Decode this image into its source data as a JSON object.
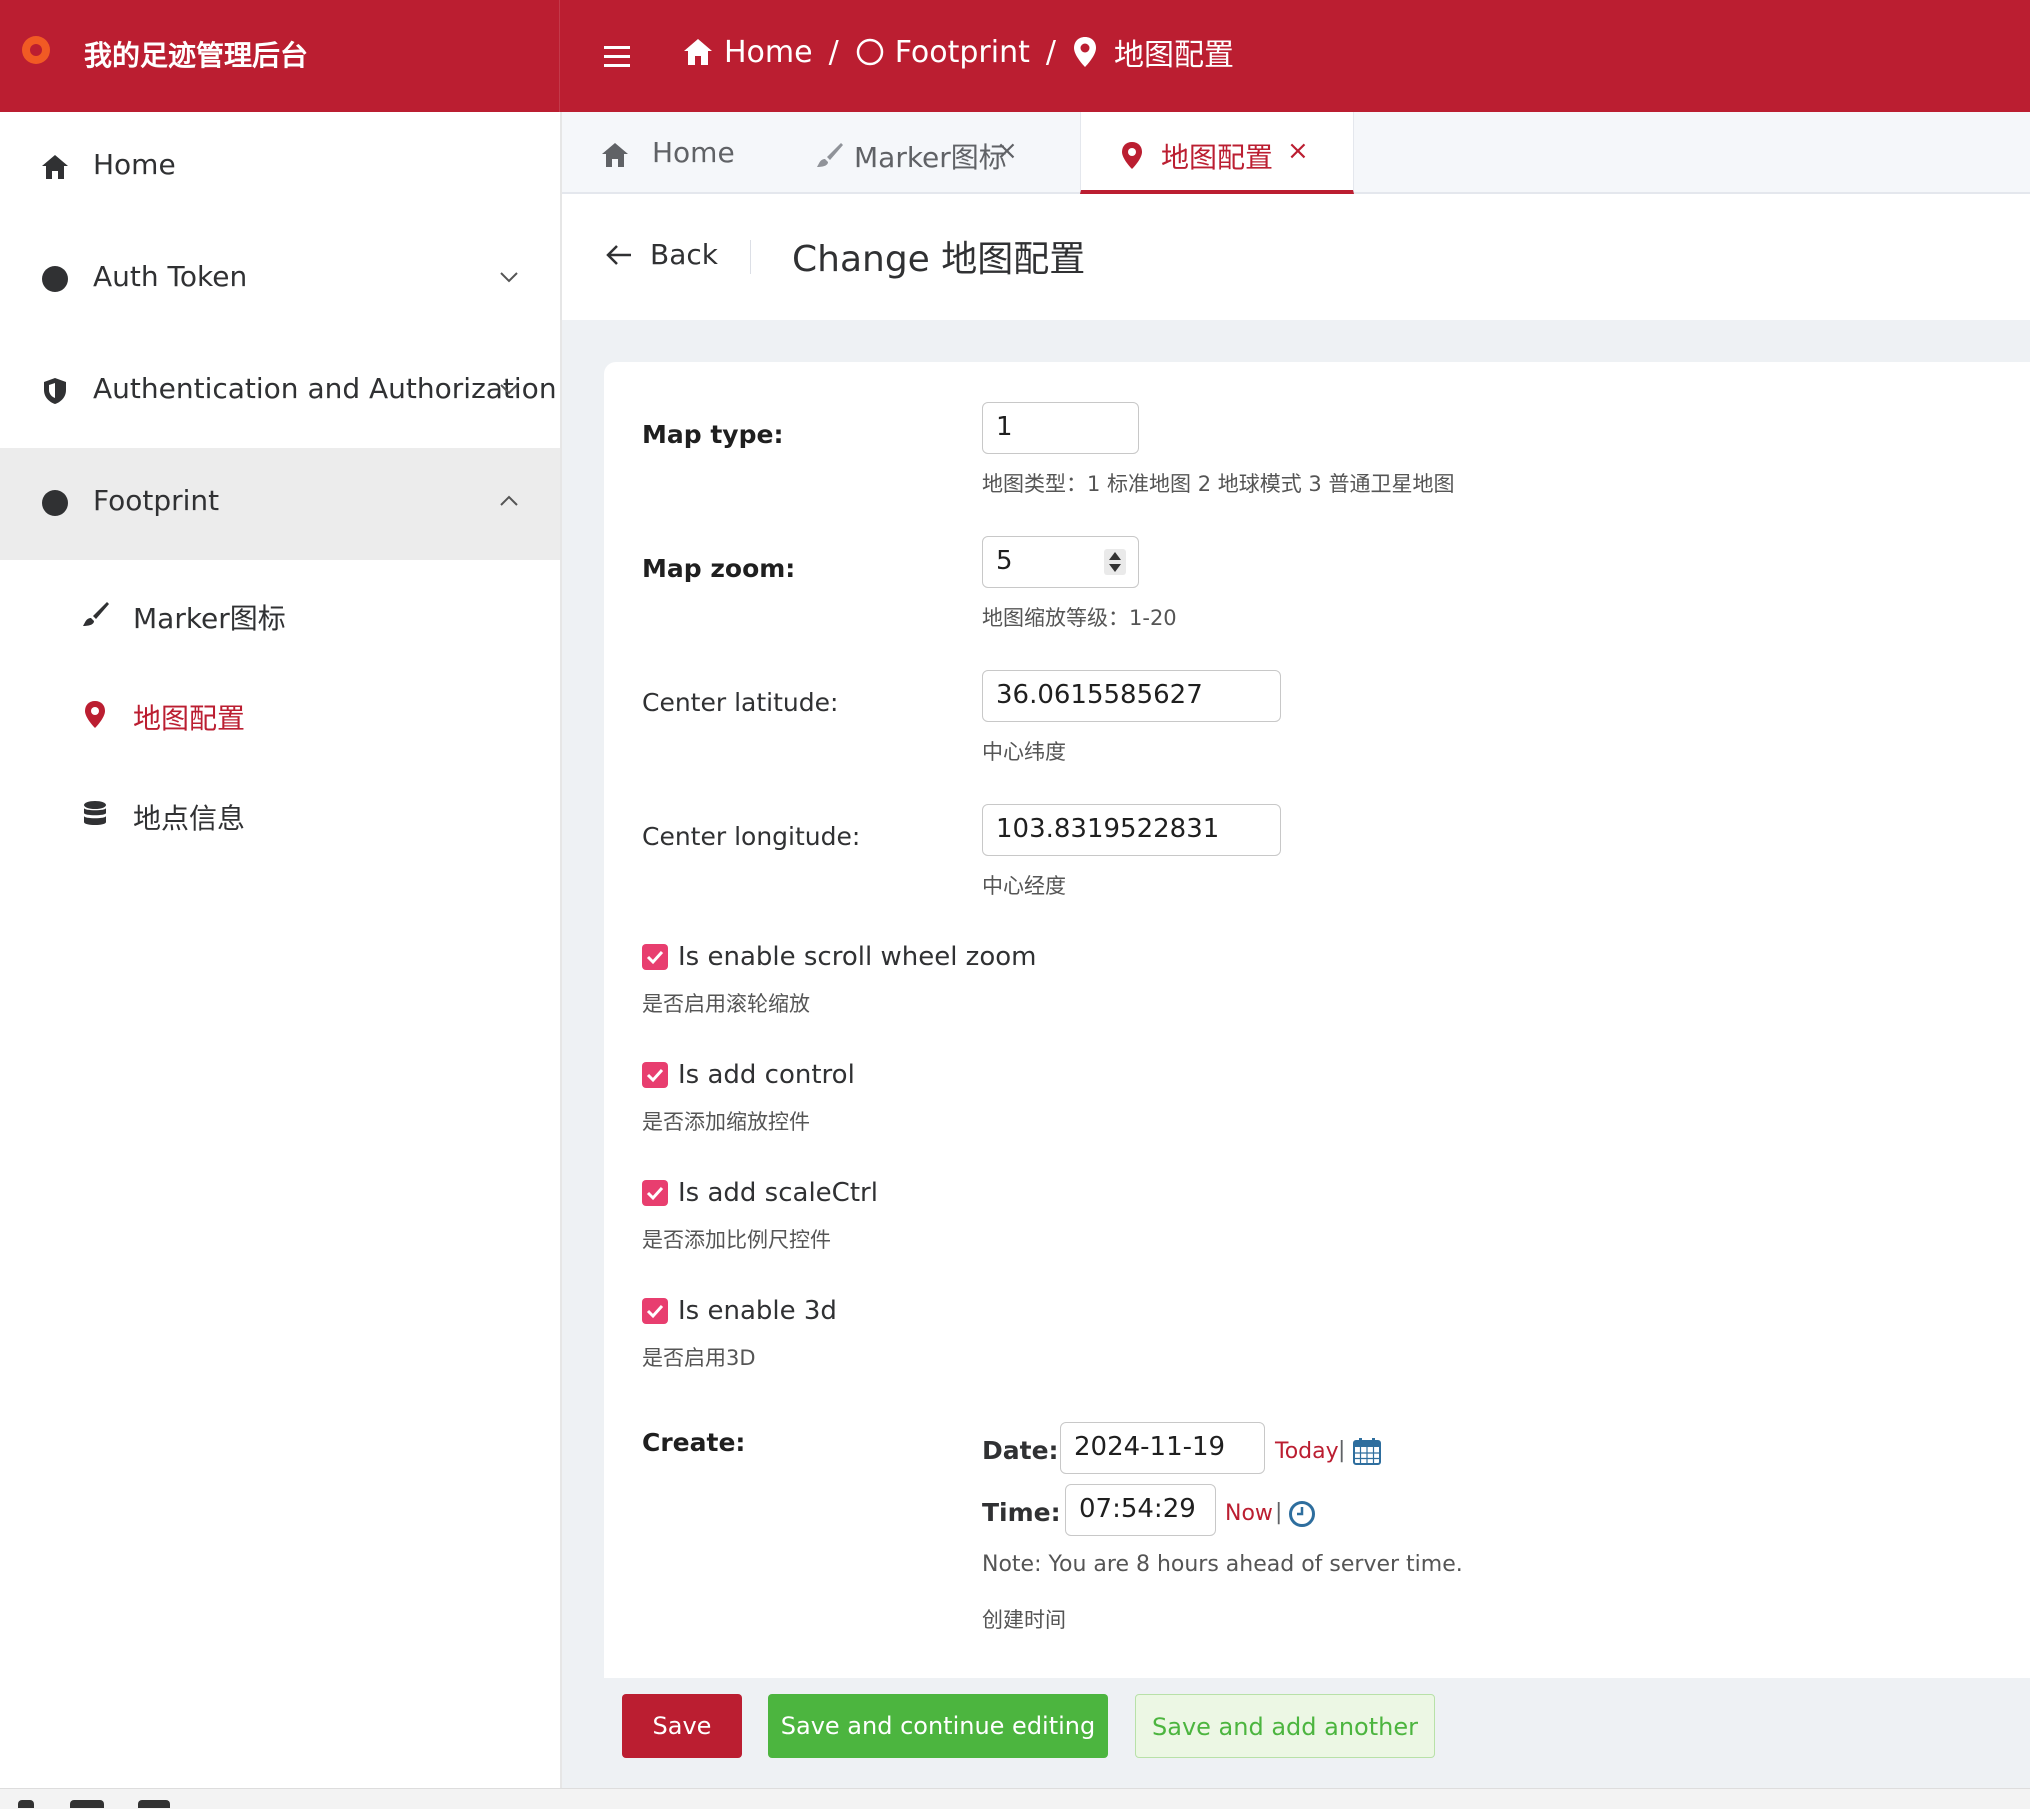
{
  "brand": {
    "title": "我的足迹管理后台"
  },
  "breadcrumb": {
    "home": "Home",
    "sep1": "/",
    "footprint": "Footprint",
    "sep2": "/",
    "current": "地图配置"
  },
  "sidebar": {
    "home": "Home",
    "auth_token": "Auth Token",
    "authn": "Authentication and Authorization",
    "footprint": "Footprint",
    "marker": "Marker图标",
    "map_config": "地图配置",
    "places": "地点信息"
  },
  "tabs": [
    {
      "label": "Home"
    },
    {
      "label": "Marker图标",
      "close": "×"
    },
    {
      "label": "地图配置",
      "close": "×"
    }
  ],
  "header": {
    "back": "Back",
    "title": "Change 地图配置"
  },
  "form": {
    "map_type": {
      "label": "Map type:",
      "value": "1",
      "help": "地图类型：1 标准地图 2 地球模式 3 普通卫星地图"
    },
    "map_zoom": {
      "label": "Map zoom:",
      "value": "5",
      "help": "地图缩放等级：1-20"
    },
    "center_lat": {
      "label": "Center latitude:",
      "value": "36.0615585627",
      "help": "中心纬度"
    },
    "center_lng": {
      "label": "Center longitude:",
      "value": "103.8319522831",
      "help": "中心经度"
    },
    "scroll_zoom": {
      "label": "Is enable scroll wheel zoom",
      "help": "是否启用滚轮缩放",
      "checked": true
    },
    "add_control": {
      "label": "Is add control",
      "help": "是否添加缩放控件",
      "checked": true
    },
    "scale_ctrl": {
      "label": "Is add scaleCtrl",
      "help": "是否添加比例尺控件",
      "checked": true
    },
    "enable_3d": {
      "label": "Is enable 3d",
      "help": "是否启用3D",
      "checked": true
    },
    "create": {
      "label": "Create:",
      "date_label": "Date:",
      "date_value": "2024-11-19",
      "today": "Today",
      "pipe": "|",
      "time_label": "Time:",
      "time_value": "07:54:29",
      "now": "Now",
      "note": "Note: You are 8 hours ahead of server time.",
      "help": "创建时间"
    }
  },
  "buttons": {
    "save": "Save",
    "save_continue": "Save and continue editing",
    "save_add": "Save and add another"
  },
  "colors": {
    "primary": "#bb1e31",
    "success": "#4cb53f",
    "checkbox": "#e83e6f",
    "calendar": "#2e6e9e"
  },
  "icons": [
    "home-icon",
    "circle-icon",
    "map-pin-icon",
    "shield-icon",
    "brush-icon",
    "database-icon",
    "calendar-icon",
    "clock-icon",
    "arrow-left-icon",
    "hamburger-icon",
    "close-icon"
  ]
}
